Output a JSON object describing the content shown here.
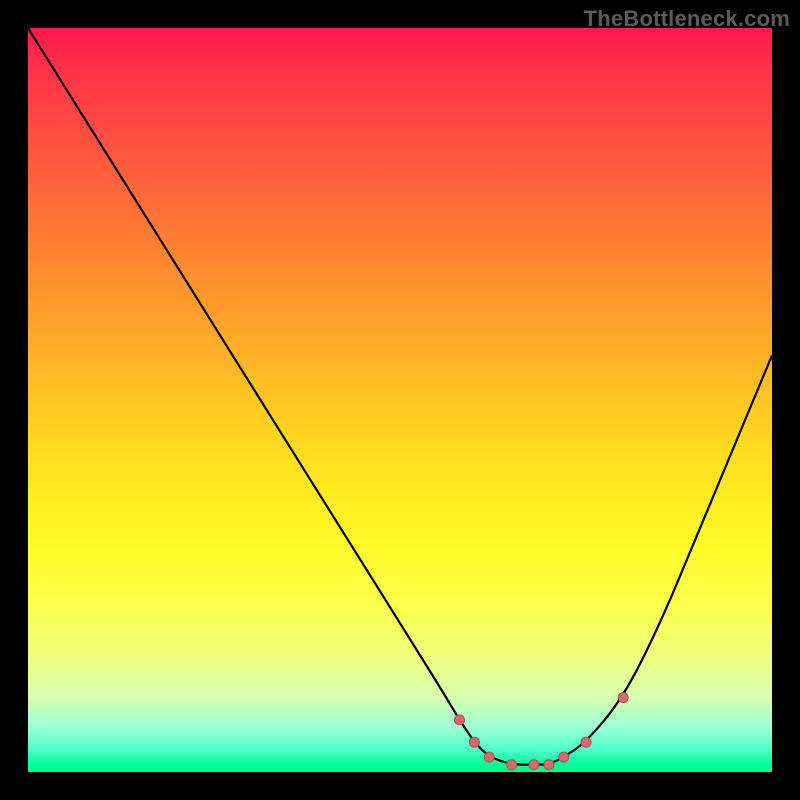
{
  "watermark": "TheBottleneck.com",
  "colors": {
    "curve": "#000000",
    "marker_fill": "#d46a6a",
    "marker_stroke": "#b24c4c"
  },
  "chart_data": {
    "type": "line",
    "title": "",
    "xlabel": "",
    "ylabel": "",
    "xlim": [
      0,
      100
    ],
    "ylim": [
      0,
      100
    ],
    "axes_visible": false,
    "background": "red-to-green vertical gradient (heat map style)",
    "series": [
      {
        "name": "bottleneck-curve",
        "x": [
          0,
          5,
          10,
          15,
          20,
          25,
          30,
          35,
          40,
          45,
          50,
          55,
          58,
          60,
          62,
          65,
          68,
          70,
          72,
          75,
          80,
          85,
          90,
          95,
          100
        ],
        "y": [
          100,
          92,
          84,
          76,
          68,
          60,
          52,
          44,
          36,
          28,
          20,
          12,
          7,
          4,
          2,
          1,
          1,
          1,
          2,
          4,
          10,
          20,
          32,
          44,
          56
        ]
      }
    ],
    "markers": [
      {
        "x": 58,
        "y": 7
      },
      {
        "x": 60,
        "y": 4
      },
      {
        "x": 62,
        "y": 2
      },
      {
        "x": 65,
        "y": 1
      },
      {
        "x": 68,
        "y": 1
      },
      {
        "x": 70,
        "y": 1
      },
      {
        "x": 72,
        "y": 2
      },
      {
        "x": 75,
        "y": 4
      },
      {
        "x": 80,
        "y": 10
      }
    ]
  }
}
